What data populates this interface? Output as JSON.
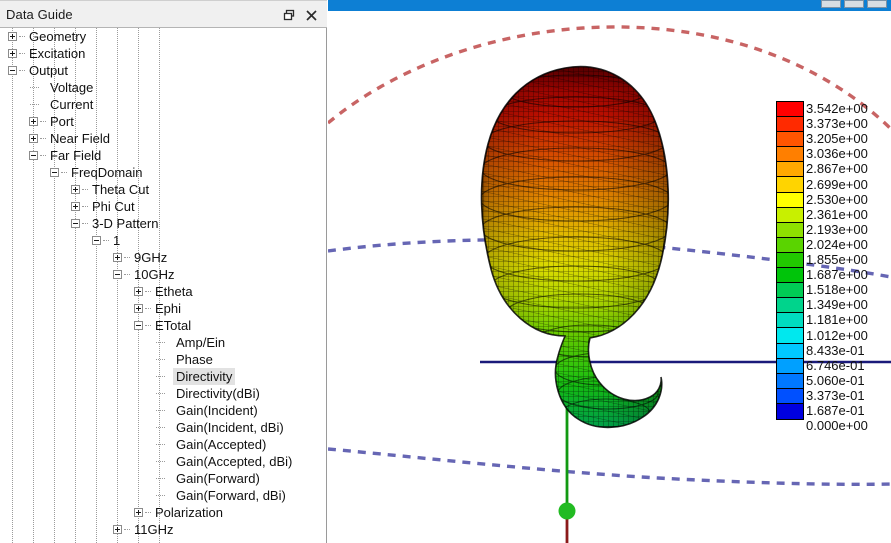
{
  "panel": {
    "title": "Data Guide",
    "float_icon": "restore-window-icon",
    "close_icon": "close-icon"
  },
  "tree": [
    {
      "label": "Geometry",
      "depth": 0,
      "state": "collapsed"
    },
    {
      "label": "Excitation",
      "depth": 0,
      "state": "collapsed"
    },
    {
      "label": "Output",
      "depth": 0,
      "state": "expanded"
    },
    {
      "label": "Voltage",
      "depth": 1,
      "state": "leaf"
    },
    {
      "label": "Current",
      "depth": 1,
      "state": "leaf"
    },
    {
      "label": "Port",
      "depth": 1,
      "state": "collapsed"
    },
    {
      "label": "Near Field",
      "depth": 1,
      "state": "collapsed"
    },
    {
      "label": "Far Field",
      "depth": 1,
      "state": "expanded"
    },
    {
      "label": "FreqDomain",
      "depth": 2,
      "state": "expanded"
    },
    {
      "label": "Theta Cut",
      "depth": 3,
      "state": "collapsed"
    },
    {
      "label": "Phi Cut",
      "depth": 3,
      "state": "collapsed"
    },
    {
      "label": "3-D Pattern",
      "depth": 3,
      "state": "expanded"
    },
    {
      "label": "1",
      "depth": 4,
      "state": "expanded"
    },
    {
      "label": "9GHz",
      "depth": 5,
      "state": "collapsed"
    },
    {
      "label": "10GHz",
      "depth": 5,
      "state": "expanded"
    },
    {
      "label": "Etheta",
      "depth": 6,
      "state": "collapsed"
    },
    {
      "label": "Ephi",
      "depth": 6,
      "state": "collapsed"
    },
    {
      "label": "ETotal",
      "depth": 6,
      "state": "expanded"
    },
    {
      "label": "Amp/Ein",
      "depth": 7,
      "state": "leaf"
    },
    {
      "label": "Phase",
      "depth": 7,
      "state": "leaf"
    },
    {
      "label": "Directivity",
      "depth": 7,
      "state": "leaf",
      "selected": true
    },
    {
      "label": "Directivity(dBi)",
      "depth": 7,
      "state": "leaf"
    },
    {
      "label": "Gain(Incident)",
      "depth": 7,
      "state": "leaf"
    },
    {
      "label": "Gain(Incident, dBi)",
      "depth": 7,
      "state": "leaf"
    },
    {
      "label": "Gain(Accepted)",
      "depth": 7,
      "state": "leaf"
    },
    {
      "label": "Gain(Accepted, dBi)",
      "depth": 7,
      "state": "leaf"
    },
    {
      "label": "Gain(Forward)",
      "depth": 7,
      "state": "leaf"
    },
    {
      "label": "Gain(Forward, dBi)",
      "depth": 7,
      "state": "leaf"
    },
    {
      "label": "Polarization",
      "depth": 6,
      "state": "collapsed"
    },
    {
      "label": "11GHz",
      "depth": 5,
      "state": "collapsed"
    }
  ],
  "colorbar": {
    "labels": [
      "3.542e+00",
      "3.373e+00",
      "3.205e+00",
      "3.036e+00",
      "2.867e+00",
      "2.699e+00",
      "2.530e+00",
      "2.361e+00",
      "2.193e+00",
      "2.024e+00",
      "1.855e+00",
      "1.687e+00",
      "1.518e+00",
      "1.349e+00",
      "1.181e+00",
      "1.012e+00",
      "8.433e-01",
      "6.746e-01",
      "5.060e-01",
      "3.373e-01",
      "1.687e-01",
      "0.000e+00"
    ],
    "band_colors": [
      "#ff0000",
      "#ff2a00",
      "#ff5500",
      "#ff7f00",
      "#ffa800",
      "#ffd400",
      "#ffff00",
      "#c8f000",
      "#8ee000",
      "#5ad400",
      "#22c800",
      "#00c40a",
      "#00cc55",
      "#00d48c",
      "#00dcc0",
      "#00e8ee",
      "#00c8ff",
      "#00a0ff",
      "#0078ff",
      "#0050ff",
      "#0000e0"
    ]
  },
  "scene": {
    "axis_vertical_color": "#119911",
    "axis_vertical_down_color": "#8b1a1a",
    "axis_horizontal_color": "#1a1a7a",
    "origin_marker_color": "#22bb22",
    "ellipse_top_color": "#c86464",
    "ellipse_mid_color": "#6666b4",
    "ellipse_bottom_color": "#6666b4",
    "titlebar_color": "#0d7fd4"
  }
}
